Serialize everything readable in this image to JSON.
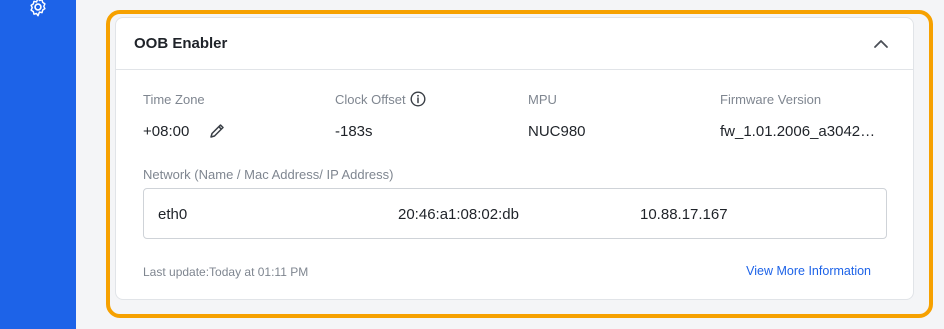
{
  "card": {
    "title": "OOB Enabler",
    "fields": [
      {
        "label": "Time Zone",
        "value": "+08:00"
      },
      {
        "label": "Clock Offset",
        "value": "-183s"
      },
      {
        "label": "MPU",
        "value": "NUC980"
      },
      {
        "label": "Firmware Version",
        "value": "fw_1.01.2006_a3042…"
      }
    ],
    "network": {
      "label": "Network (Name / Mac Address/ IP Address)",
      "name": "eth0",
      "mac": "20:46:a1:08:02:db",
      "ip": "10.88.17.167"
    },
    "last_update": "Last update:Today at 01:11 PM",
    "view_more": "View More Information"
  },
  "icons": {
    "sidebar": "gear-icon",
    "collapse": "chevron-up-icon",
    "clock_offset_info": "info-icon",
    "timezone_edit": "pencil-icon"
  },
  "colors": {
    "sidebar": "#1d63e8",
    "highlight": "#f6a100",
    "link": "#1d63e8"
  }
}
